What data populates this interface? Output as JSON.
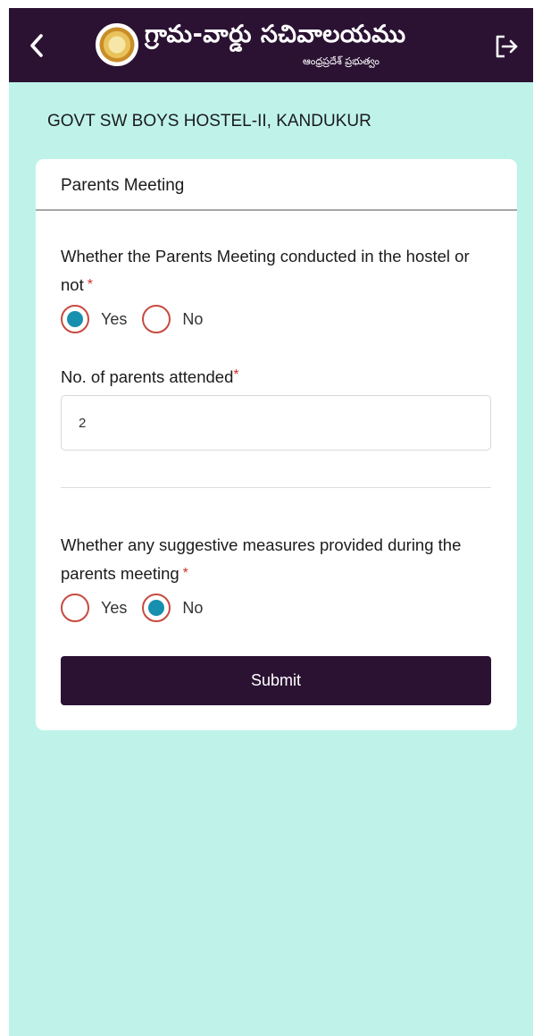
{
  "header": {
    "back_icon": "chevron-left-icon",
    "logo_icon": "government-emblem-icon",
    "brand_title": "గ్రామ-వార్డు సచివాలయము",
    "brand_subtitle": "ఆంధ్రప్రదేశ్ ప్రభుత్వం",
    "logout_icon": "logout-icon",
    "bar_color": "#2b1233"
  },
  "hostel_name": "GOVT SW BOYS HOSTEL-II, KANDUKUR",
  "form": {
    "title": "Parents Meeting",
    "q1": {
      "label": "Whether the Parents Meeting conducted in the hostel or not",
      "required_mark": "*",
      "options": [
        "Yes",
        "No"
      ],
      "selected": "Yes"
    },
    "parents_attended": {
      "label": "No. of parents attended",
      "required_mark": "*",
      "value": "2"
    },
    "q2": {
      "label": "Whether any suggestive measures provided during the parents meeting",
      "required_mark": "*",
      "options": [
        "Yes",
        "No"
      ],
      "selected": "No"
    },
    "submit_label": "Submit"
  },
  "colors": {
    "background": "#bff3ea",
    "accent": "#2b1233",
    "radio_selected": "#178fae",
    "radio_border": "#c64a3f",
    "required": "#d2312c"
  }
}
